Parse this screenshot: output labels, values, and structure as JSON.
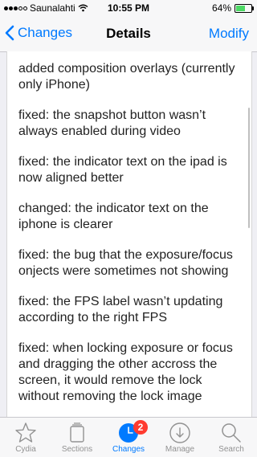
{
  "statusbar": {
    "carrier": "Saunalahti",
    "time": "10:55 PM",
    "battery": "64%",
    "battery_level": 0.64
  },
  "navbar": {
    "back_label": "Changes",
    "title": "Details",
    "right_label": "Modify"
  },
  "notes": [
    "added composition overlays (currently only iPhone)",
    "fixed: the snapshot button wasn’t always enabled during video",
    "fixed: the indicator text on the ipad is now aligned better",
    "changed: the indicator text on the iphone is clearer",
    "fixed: the bug that the exposure/focus onjects were sometimes not showing",
    "fixed: the FPS label wasn’t updating according to the right FPS",
    "fixed: when locking exposure or focus and dragging the other accross the screen, it would remove the lock without removing the lock image"
  ],
  "tabs": [
    {
      "label": "Cydia",
      "icon": "star-icon"
    },
    {
      "label": "Sections",
      "icon": "sections-icon"
    },
    {
      "label": "Changes",
      "icon": "clock-icon",
      "badge": "2",
      "active": true
    },
    {
      "label": "Manage",
      "icon": "download-icon"
    },
    {
      "label": "Search",
      "icon": "search-icon"
    }
  ],
  "colors": {
    "accent": "#007aff",
    "badge": "#ff3b30",
    "battery": "#4cd964"
  }
}
